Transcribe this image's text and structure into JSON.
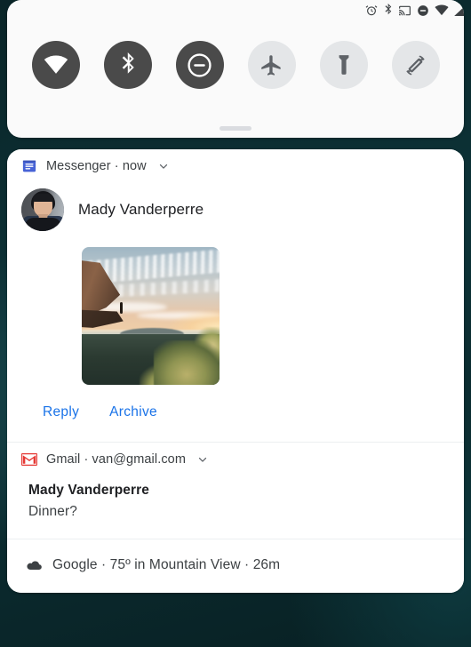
{
  "statusbar": {
    "icons": [
      "alarm-icon",
      "bluetooth-icon",
      "cast-icon",
      "do-not-disturb-icon",
      "wifi-icon",
      "cell-signal-icon"
    ]
  },
  "quick_settings": {
    "handle": "drag-handle",
    "tiles": [
      {
        "name": "wifi-tile",
        "icon": "wifi-icon",
        "state": "on"
      },
      {
        "name": "bluetooth-tile",
        "icon": "bluetooth-icon",
        "state": "on"
      },
      {
        "name": "dnd-tile",
        "icon": "do-not-disturb-icon",
        "state": "on"
      },
      {
        "name": "airplane-tile",
        "icon": "airplane-icon",
        "state": "off"
      },
      {
        "name": "flashlight-tile",
        "icon": "flashlight-icon",
        "state": "off"
      },
      {
        "name": "auto-rotate-tile",
        "icon": "auto-rotate-icon",
        "state": "off"
      }
    ]
  },
  "notifications": [
    {
      "app": "Messenger",
      "header": "Messenger · now",
      "app_icon": "messenger-icon",
      "expand_icon": "chevron-down-icon",
      "sender": "Mady Vanderperre",
      "avatar": "sender-avatar",
      "image": "sunset-cliff-photo",
      "actions": [
        "Reply",
        "Archive"
      ]
    },
    {
      "app": "Gmail",
      "header": "Gmail · van@gmail.com",
      "app_icon": "gmail-icon",
      "expand_icon": "chevron-down-icon",
      "title": "Mady Vanderperre",
      "text": "Dinner?"
    },
    {
      "app": "Google",
      "header": "Google · 75º in Mountain View · 26m",
      "app_icon": "cloud-icon"
    }
  ],
  "colors": {
    "accent_link": "#1a73e8",
    "tile_on_bg": "#4a4a4a",
    "tile_off_bg": "#e4e6e8",
    "panel_bg": "#fafafa",
    "card_bg": "#ffffff",
    "wallpaper": "#0d3338"
  }
}
